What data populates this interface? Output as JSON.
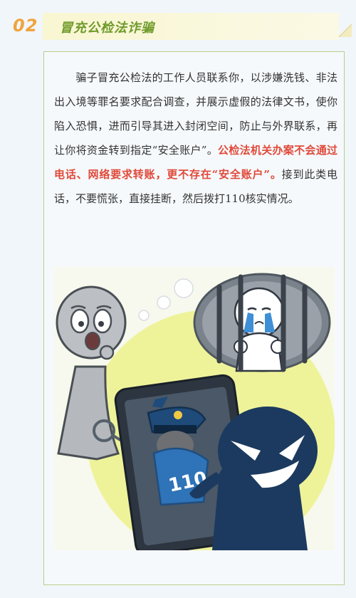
{
  "section": {
    "number": "02",
    "title": "冒充公检法诈骗"
  },
  "content": {
    "lead": "骗子冒充公检法的工作人员联系你，以涉嫌洗钱、非法出入境等罪名要求配合调查，并展示虚假的法律文书，使你陷入恐惧，进而引导其进入封闭空间，防止与外界联系，再让你将资金转到指定“安全账户”。",
    "highlight": "公检法机关办案不会通过电话、网络要求转账，更不存在“安全账户”。",
    "tail": "接到此类电话，不要慌张，直接挂断，然后拨打110核实情况。"
  },
  "illustration": {
    "badge_text": "110"
  },
  "colors": {
    "number": "#f0a33c",
    "title": "#6f9b2a",
    "highlight": "#e04a3a",
    "card_border": "#b6cf8a",
    "scammer": "#1c3a5f"
  }
}
